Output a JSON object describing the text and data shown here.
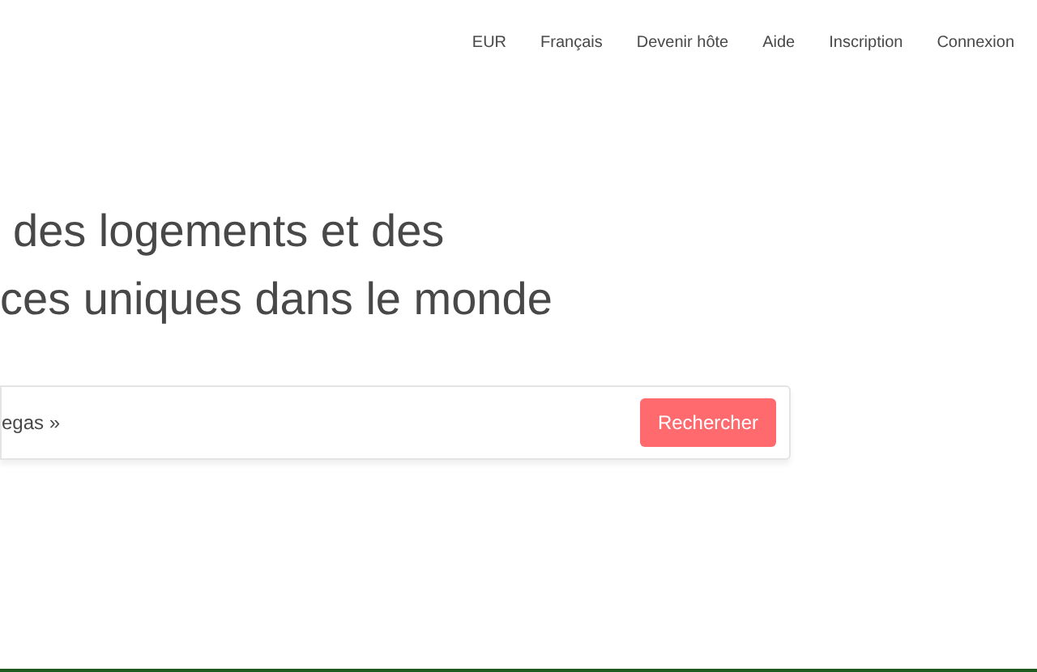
{
  "nav": {
    "items": [
      "EUR",
      "Français",
      "Devenir hôte",
      "Aide",
      "Inscription",
      "Connexion"
    ]
  },
  "hero": {
    "heading_lines": [
      "des logements et des",
      "ces uniques dans le monde"
    ]
  },
  "search": {
    "placeholder": "egas »",
    "button": "Rechercher"
  }
}
